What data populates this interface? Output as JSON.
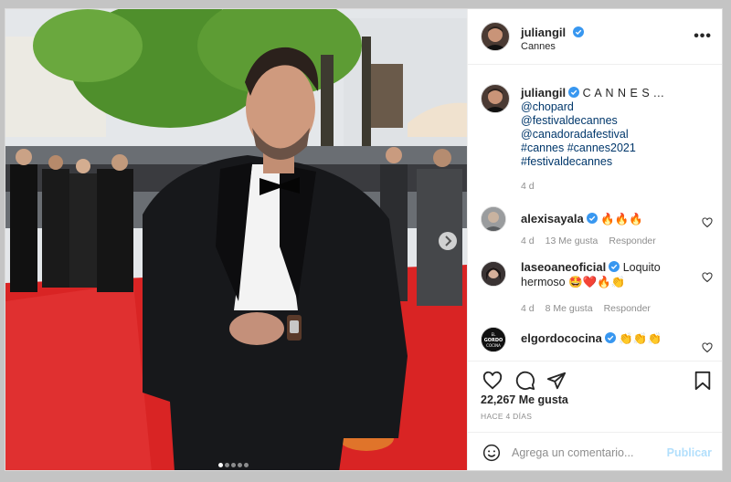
{
  "post": {
    "username": "juliangil",
    "location": "Cannes",
    "more_label": "•••",
    "caption": {
      "username": "juliangil",
      "text": "C A N N E S ...",
      "tags": [
        "@chopard",
        "@festivaldecannes",
        "@canadoradafestival",
        "#cannes #cannes2021",
        "#festivaldecannes"
      ],
      "time": "4 d"
    },
    "comments": [
      {
        "username": "alexisayala",
        "text": "🔥🔥🔥",
        "time": "4 d",
        "likes": "13 Me gusta",
        "reply": "Responder"
      },
      {
        "username": "laseoaneoficial",
        "text": "Loquito hermoso 🤩❤️🔥👏",
        "time": "4 d",
        "likes": "8 Me gusta",
        "reply": "Responder"
      },
      {
        "username": "elgordococina",
        "text": "👏👏👏"
      }
    ],
    "likes": "22,267 Me gusta",
    "ago": "HACE 4 DÍAS",
    "add_comment_placeholder": "Agrega un comentario...",
    "post_button": "Publicar",
    "avatar_text": "EL GORDO COCINA"
  },
  "colors": {
    "link": "#00376b",
    "verified": "#3897f0",
    "muted": "#8e8e8e",
    "post_disabled": "#b2dffc"
  },
  "carousel": {
    "count": 5,
    "active": 1
  }
}
